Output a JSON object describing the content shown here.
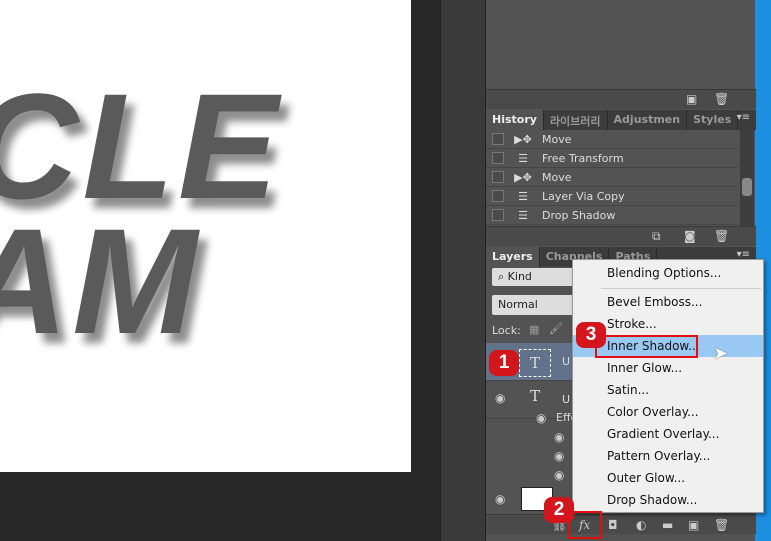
{
  "canvas": {
    "line1": "CLE",
    "line2": "AM"
  },
  "history": {
    "tabs": [
      "History",
      "라이브러리",
      "Adjustmen",
      "Styles"
    ],
    "items": [
      {
        "icon": "move-icon",
        "label": "Move"
      },
      {
        "icon": "document-icon",
        "label": "Free Transform"
      },
      {
        "icon": "move-icon",
        "label": "Move"
      },
      {
        "icon": "document-icon",
        "label": "Layer Via Copy"
      },
      {
        "icon": "document-icon",
        "label": "Drop Shadow"
      }
    ]
  },
  "layers": {
    "tabs": [
      "Layers",
      "Channels",
      "Paths"
    ],
    "filter": "Kind",
    "blend_mode": "Normal",
    "lock_label": "Lock:",
    "rows": [
      {
        "name": "U"
      },
      {
        "name": "U"
      },
      {
        "name": "Effe"
      }
    ]
  },
  "menu": {
    "items": [
      "Blending Options...",
      "Bevel  Emboss...",
      "Stroke...",
      "Inner Shadow...",
      "Inner Glow...",
      "Satin...",
      "Color Overlay...",
      "Gradient Overlay...",
      "Pattern Overlay...",
      "Outer Glow...",
      "Drop Shadow..."
    ],
    "highlighted": "Inner Shadow..."
  },
  "badges": [
    "1",
    "2",
    "3"
  ],
  "fx_label": "fx",
  "colors": {
    "accent": "#d3151c",
    "highlight": "#99c9f3",
    "desktop": "#1d8fe0"
  }
}
